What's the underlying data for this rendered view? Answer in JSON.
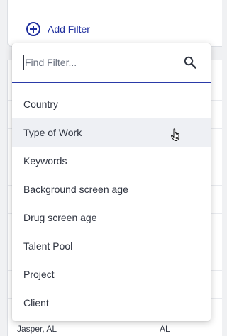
{
  "toolbar": {
    "add_filter_label": "Add Filter"
  },
  "search": {
    "placeholder": "Find Filter..."
  },
  "filter_options": [
    {
      "label": "Country"
    },
    {
      "label": "Type of Work"
    },
    {
      "label": "Keywords"
    },
    {
      "label": "Background screen age"
    },
    {
      "label": "Drug screen age"
    },
    {
      "label": "Talent Pool"
    },
    {
      "label": "Project"
    },
    {
      "label": "Client"
    }
  ],
  "hovered_option": "Type of Work",
  "table_visible_row": {
    "city": "Jasper, AL",
    "state": "AL"
  },
  "colors": {
    "accent": "#1f2f9e",
    "hover": "#eef0f4"
  },
  "icons": {
    "add": "plus-circle-icon",
    "search": "search-icon",
    "cursor": "hand-pointer-icon"
  }
}
